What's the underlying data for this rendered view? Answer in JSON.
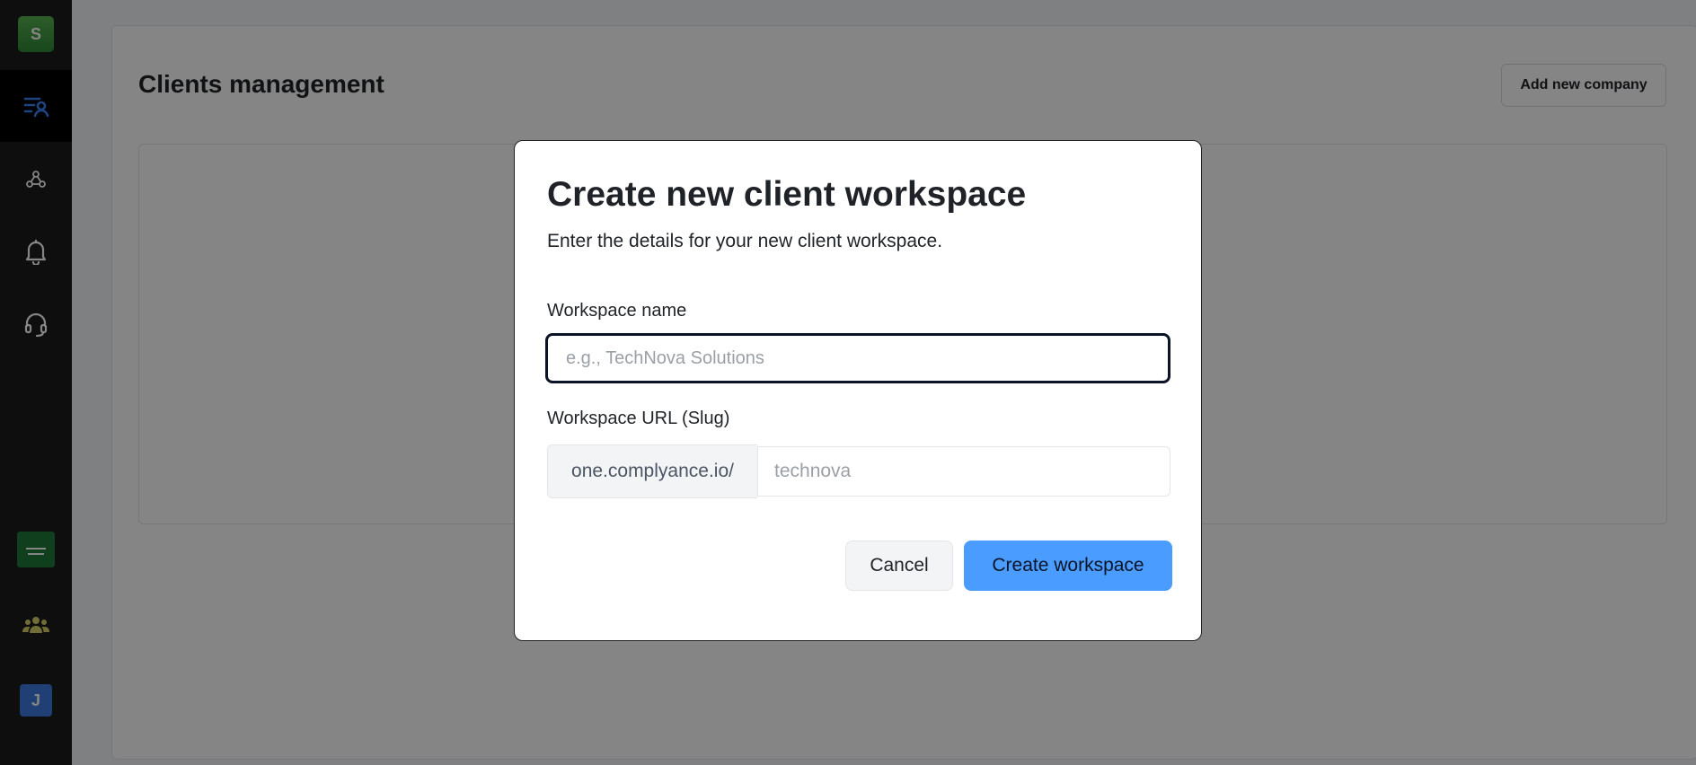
{
  "sidebar": {
    "logo_letter": "S",
    "avatar_letter": "J",
    "items": [
      {
        "icon": "clients-list-icon",
        "active": true
      },
      {
        "icon": "webhook-icon"
      },
      {
        "icon": "bell-icon"
      },
      {
        "icon": "headset-icon"
      },
      {
        "icon": "saudi-flag-icon"
      },
      {
        "icon": "team-icon"
      }
    ]
  },
  "page": {
    "title": "Clients management",
    "add_company_label": "Add new company"
  },
  "modal": {
    "title": "Create new client workspace",
    "subtitle": "Enter the details for your new client workspace.",
    "name_label": "Workspace name",
    "name_placeholder": "e.g., TechNova Solutions",
    "slug_label": "Workspace URL (Slug)",
    "slug_prefix": "one.complyance.io/",
    "slug_placeholder": "technova",
    "cancel_label": "Cancel",
    "create_label": "Create workspace"
  },
  "colors": {
    "sidebar_bg": "#1c1c1c",
    "accent": "#4b9cff",
    "active_icon": "#3b82f6",
    "team_icon": "#d9d26a"
  }
}
